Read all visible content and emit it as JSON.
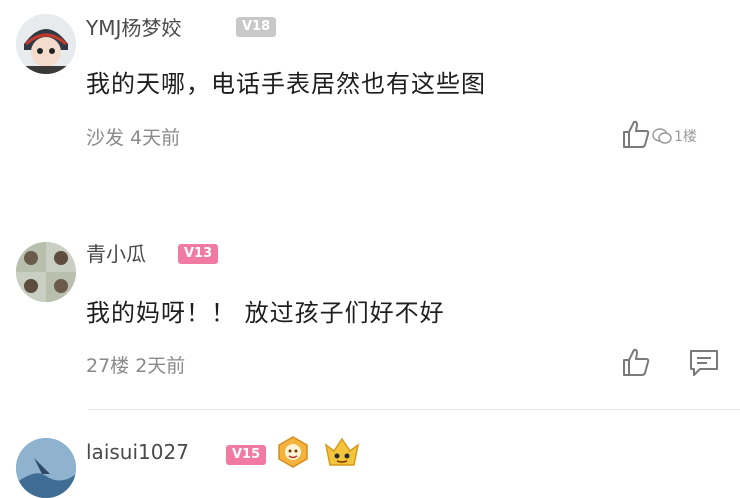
{
  "comments": [
    {
      "username": "YMJ杨梦姣",
      "level": "V18",
      "level_color": "#c8c8c8",
      "text": "我的天哪，电话手表居然也有这些图",
      "meta": "沙发  4天前",
      "watermark": "1楼"
    },
    {
      "username": "青小瓜",
      "level": "V13",
      "level_color": "#f07aa2",
      "text": "我的妈呀！！ 放过孩子们好不好",
      "meta": "27楼  2天前"
    },
    {
      "username": "laisui1027",
      "level": "V15",
      "level_color": "#f07aa2"
    }
  ]
}
